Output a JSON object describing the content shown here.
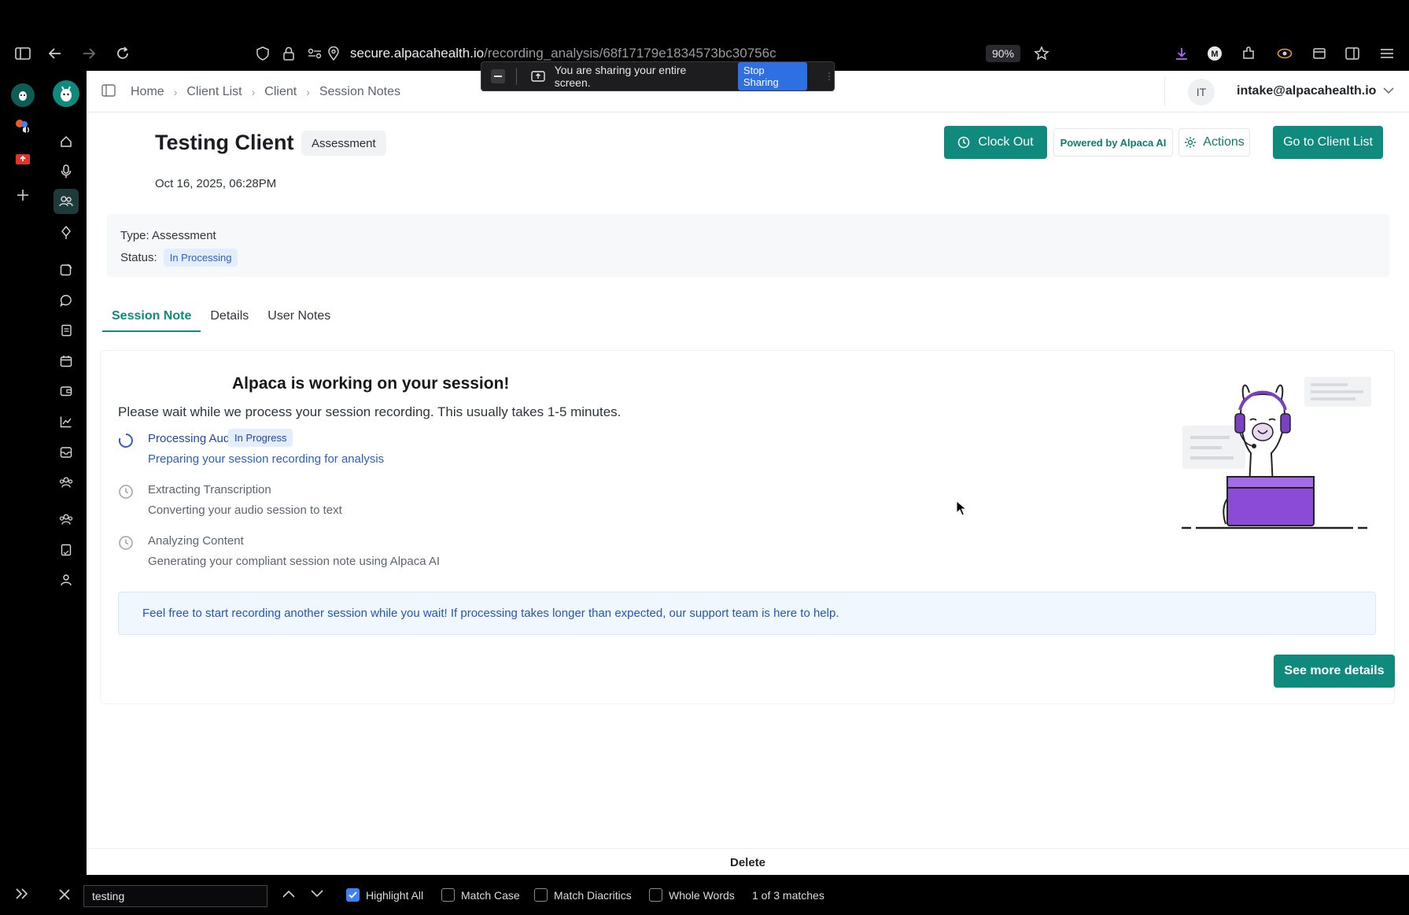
{
  "browser": {
    "url_host": "secure.alpacahealth.io",
    "url_path": "/recording_analysis/68f17179e1834573bc30756c",
    "zoom": "90%"
  },
  "share_banner": {
    "text": "You are sharing your entire screen.",
    "stop_label": "Stop Sharing"
  },
  "breadcrumb": [
    "Home",
    "Client List",
    "Client",
    "Session Notes"
  ],
  "user": {
    "initials": "IT",
    "email": "intake@alpacahealth.io"
  },
  "header": {
    "client_name": "Testing Client",
    "session_type_chip": "Assessment",
    "date": "Oct 16, 2025, 06:28PM",
    "clock_out_label": "Clock Out",
    "powered_by_label": "Powered by Alpaca AI",
    "actions_label": "Actions",
    "go_client_list_label": "Go to Client List"
  },
  "info": {
    "type_text": "Type: Assessment",
    "status_label": "Status:",
    "status_value": "In Processing"
  },
  "tabs": [
    {
      "label": "Session Note"
    },
    {
      "label": "Details"
    },
    {
      "label": "User Notes"
    }
  ],
  "processing": {
    "title": "Alpaca is working on your session!",
    "subtitle": "Please wait while we process your session recording. This usually takes 1-5 minutes.",
    "steps": [
      {
        "title": "Processing Audio",
        "badge": "In Progress",
        "desc": "Preparing your session recording for analysis"
      },
      {
        "title": "Extracting Transcription",
        "desc": "Converting your audio session to text"
      },
      {
        "title": "Analyzing Content",
        "desc": "Generating your compliant session note using Alpaca AI"
      }
    ],
    "notice": "Feel free to start recording another session while you wait! If processing takes longer than expected, our support team is here to help.",
    "see_more_label": "See more details"
  },
  "footer": {
    "delete_label": "Delete"
  },
  "find_bar": {
    "query": "testing",
    "options": [
      {
        "label": "Highlight All",
        "checked": true
      },
      {
        "label": "Match Case",
        "checked": false
      },
      {
        "label": "Match Diacritics",
        "checked": false
      },
      {
        "label": "Whole Words",
        "checked": false
      }
    ],
    "match_text": "1 of 3 matches"
  },
  "colors": {
    "accent": "#0f8a7c",
    "info_blue": "#2b5fc4",
    "progress_blue": "#2149a8"
  },
  "icons": {
    "rail": [
      "home-icon",
      "mic-icon",
      "clients-icon",
      "pen-icon",
      "notes-icon",
      "chat-icon",
      "documents-icon",
      "calendar-icon",
      "wallet-icon",
      "chart-icon",
      "inbox-icon",
      "group-icon",
      "team-icon",
      "forms-icon",
      "profile-icon"
    ]
  }
}
